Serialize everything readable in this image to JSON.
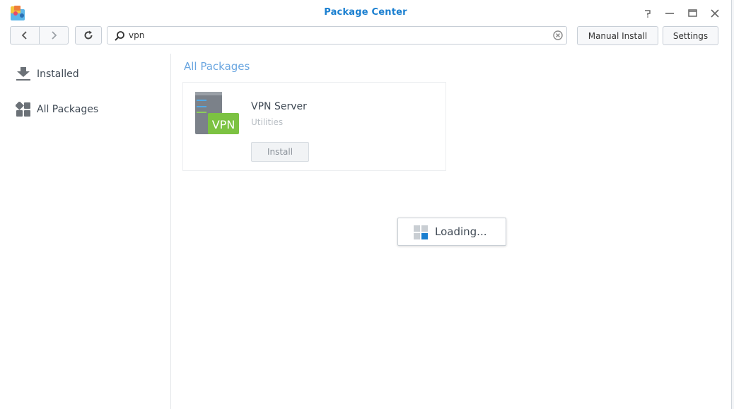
{
  "window": {
    "title": "Package Center",
    "controls": [
      "help-icon",
      "minimize-icon",
      "maximize-icon",
      "close-icon"
    ]
  },
  "toolbar": {
    "search_value": "vpn",
    "search_placeholder": "",
    "manual_install_label": "Manual Install",
    "settings_label": "Settings"
  },
  "sidebar": {
    "items": [
      {
        "label": "Installed",
        "icon": "download-icon"
      },
      {
        "label": "All Packages",
        "icon": "grid-icon"
      }
    ]
  },
  "main": {
    "section_title": "All Packages",
    "packages": [
      {
        "name": "VPN Server",
        "category": "Utilities",
        "icon_badge": "VPN",
        "action_label": "Install"
      }
    ],
    "loading_text": "Loading..."
  },
  "colors": {
    "title": "#1a7fd0",
    "section_title": "#6aa6e0",
    "vpn_badge": "#7cc242",
    "loading_accent": "#1a7fd0"
  }
}
